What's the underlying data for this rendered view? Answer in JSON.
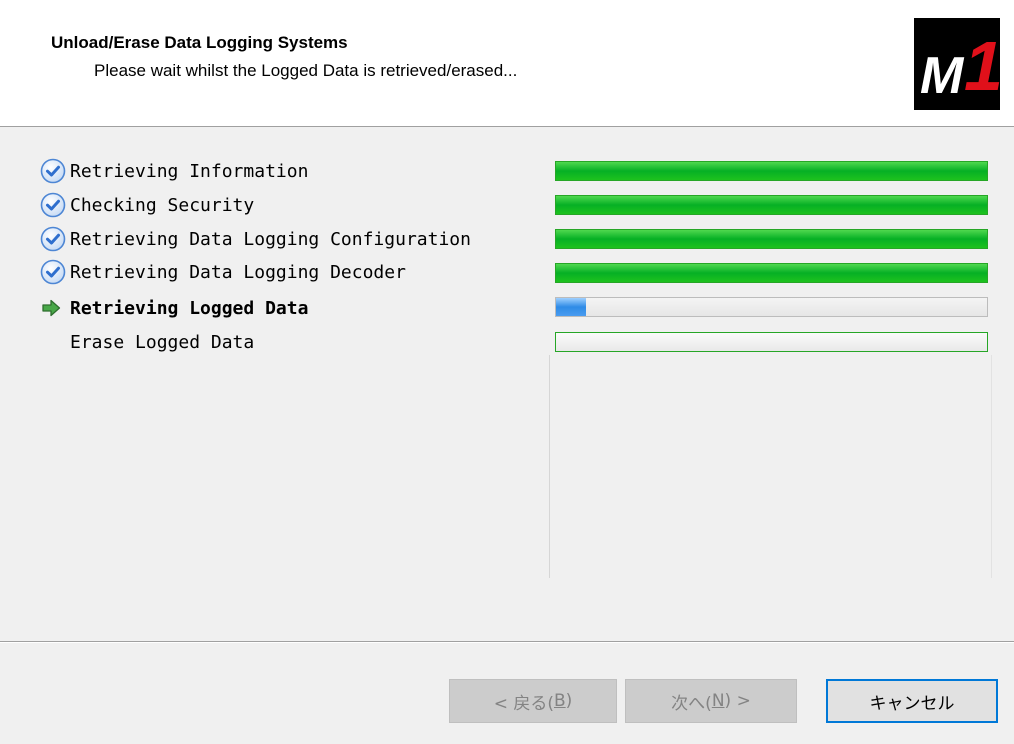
{
  "header": {
    "title": "Unload/Erase Data Logging Systems",
    "subtitle": "Please wait whilst the Logged Data is retrieved/erased...",
    "logo": {
      "text_main": "M",
      "text_accent": "1",
      "accent_color": "#e0101a"
    }
  },
  "steps": [
    {
      "label": "Retrieving Information",
      "status": "done",
      "icon": "check-circle-icon",
      "progress": 1.0
    },
    {
      "label": "Checking Security",
      "status": "done",
      "icon": "check-circle-icon",
      "progress": 1.0
    },
    {
      "label": "Retrieving Data Logging Configuration",
      "status": "done",
      "icon": "check-circle-icon",
      "progress": 1.0
    },
    {
      "label": "Retrieving Data Logging Decoder",
      "status": "done",
      "icon": "check-circle-icon",
      "progress": 1.0
    },
    {
      "label": "Retrieving Logged Data",
      "status": "current",
      "icon": "arrow-right-icon",
      "progress": 0.07
    },
    {
      "label": "Erase Logged Data",
      "status": "pending",
      "icon": "",
      "progress": 0.0
    }
  ],
  "buttons": {
    "back": {
      "label": "< 戻る(",
      "mnemonic": "B",
      "suffix": ")",
      "enabled": false
    },
    "next": {
      "label": "次へ(",
      "mnemonic": "N",
      "suffix": ") >",
      "enabled": false
    },
    "cancel": {
      "label": "キャンセル",
      "enabled": true
    }
  },
  "colors": {
    "done": "#06b025",
    "active": "#2f8be6",
    "default_button_border": "#0078d7"
  }
}
